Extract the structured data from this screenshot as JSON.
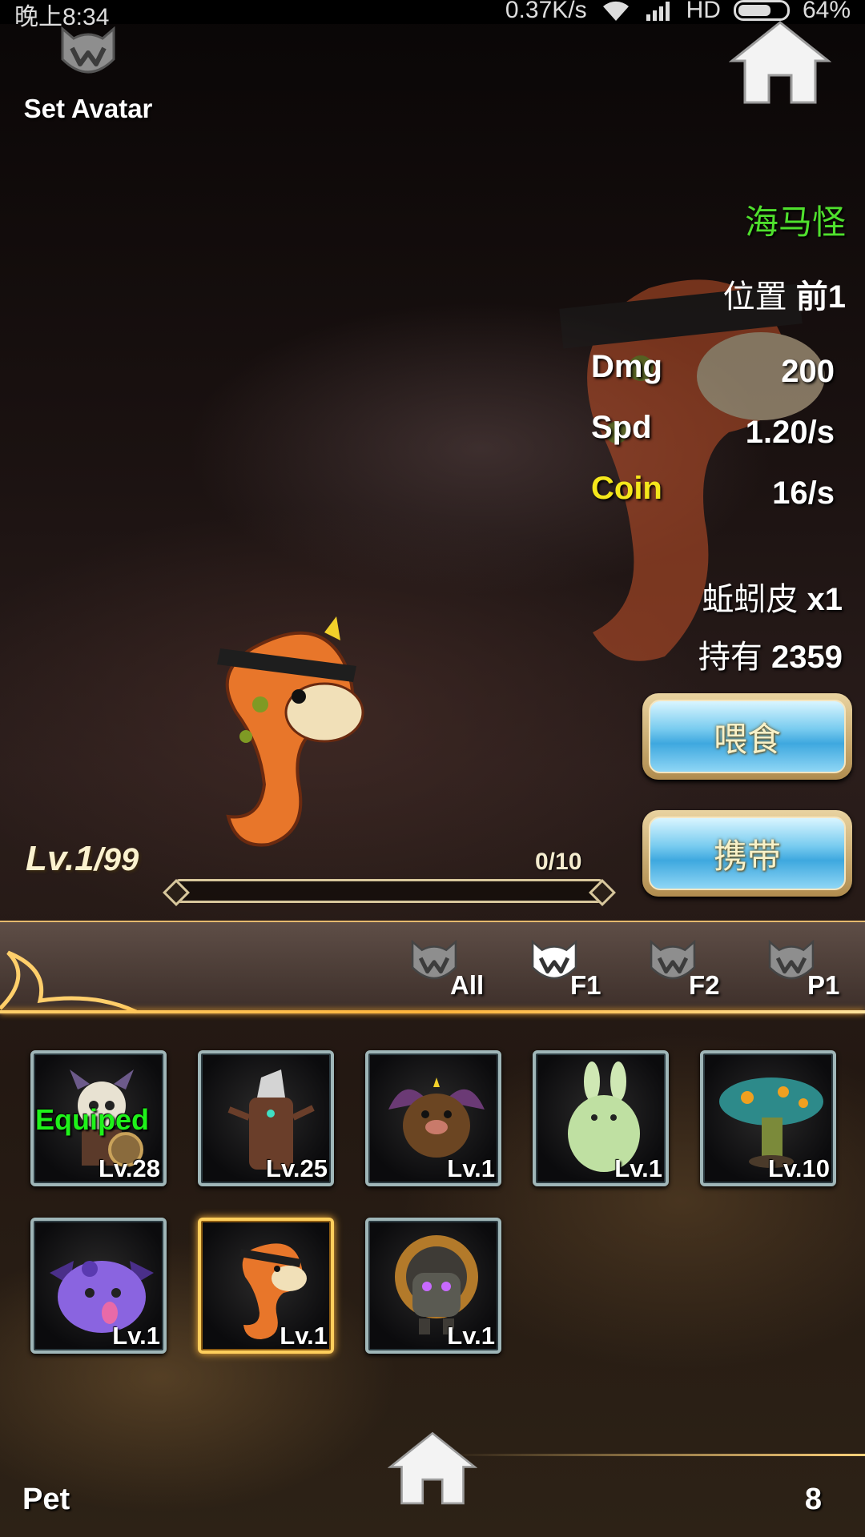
{
  "status_bar": {
    "time": "晚上8:34",
    "speed": "0.37K/s",
    "network": "HD",
    "battery": "64%"
  },
  "header": {
    "set_avatar_label": "Set Avatar"
  },
  "pet_info": {
    "name": "海马怪",
    "position_label": "位置",
    "position_value": "前1",
    "stats": [
      {
        "label": "Dmg",
        "value": "200"
      },
      {
        "label": "Spd",
        "value": "1.20/s"
      },
      {
        "label": "Coin",
        "value": "16/s"
      }
    ],
    "material_name": "蚯蚓皮",
    "material_qty": "x1",
    "owned_label": "持有",
    "owned_value": "2359"
  },
  "actions": {
    "feed_label": "喂食",
    "carry_label": "携带"
  },
  "level": {
    "current": "Lv.1",
    "max": "/99",
    "exp_text": "0/10",
    "exp_progress": 0
  },
  "filters": [
    {
      "label": "All",
      "active": false
    },
    {
      "label": "F1",
      "active": true
    },
    {
      "label": "F2",
      "active": false
    },
    {
      "label": "P1",
      "active": false
    }
  ],
  "pets": [
    {
      "name": "skeleton-viking",
      "level": "Lv.28",
      "equipped": "Equiped"
    },
    {
      "name": "tree-stump",
      "level": "Lv.25"
    },
    {
      "name": "bat-pig",
      "level": "Lv.1"
    },
    {
      "name": "green-rabbit",
      "level": "Lv.1"
    },
    {
      "name": "mushroom",
      "level": "Lv.10"
    },
    {
      "name": "purple-slime",
      "level": "Lv.1"
    },
    {
      "name": "seahorse",
      "level": "Lv.1",
      "selected": true
    },
    {
      "name": "gear-robot",
      "level": "Lv.1"
    }
  ],
  "footer": {
    "left_label": "Pet",
    "right_count": "8"
  },
  "colors": {
    "name_green": "#4fe02d",
    "coin_yellow": "#f5e71b",
    "equipped_green": "#1ff21a",
    "gold": "#ffcf5c"
  }
}
